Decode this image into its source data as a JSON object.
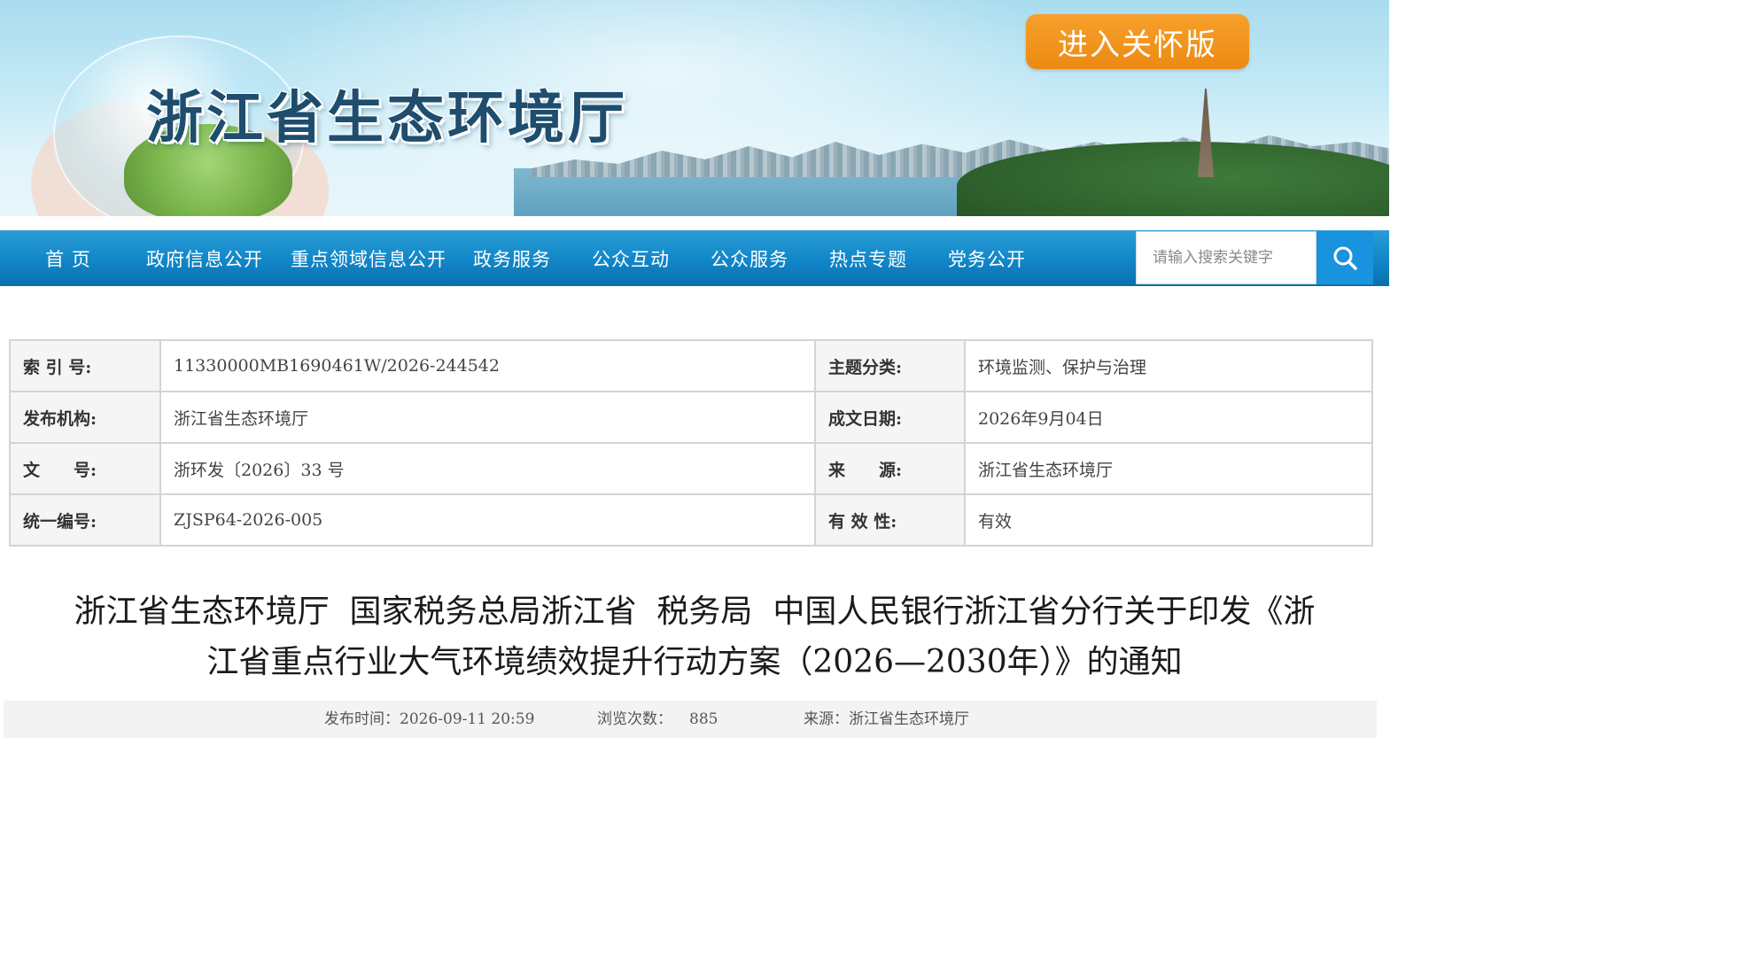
{
  "header": {
    "site_title": "浙江省生态环境厅",
    "care_button": "进入关怀版"
  },
  "nav": {
    "items": [
      "首 页",
      "政府信息公开",
      "重点领域信息公开",
      "政务服务",
      "公众互动",
      "公众服务",
      "热点专题",
      "党务公开"
    ],
    "search_placeholder": "请输入搜索关键字"
  },
  "meta": {
    "rows": [
      {
        "k1": "索 引 号:",
        "v1": "11330000MB1690461W/2026-244542",
        "k2": "主题分类:",
        "v2": "环境监测、保护与治理"
      },
      {
        "k1": "发布机构:",
        "v1": "浙江省生态环境厅",
        "k2": "成文日期:",
        "v2": "2026年9月04日"
      },
      {
        "k1": "文　　号:",
        "v1": "浙环发〔2026〕33 号",
        "k2": "来　　源:",
        "v2": "浙江省生态环境厅"
      },
      {
        "k1": "统一编号:",
        "v1": "ZJSP64-2026-005",
        "k2": "有 效 性:",
        "v2": "有效"
      }
    ]
  },
  "article": {
    "title_line1": "浙江省生态环境厅  国家税务总局浙江省  税务局  中国人民银行浙江省分行关于印发《浙",
    "title_line2": "江省重点行业大气环境绩效提升行动方案（2026—2030年）》的通知",
    "publish_time": "发布时间：2026-09-11 20:59",
    "views_label": "浏览次数：",
    "views_count": "885",
    "source": "来源：浙江省生态环境厅"
  },
  "colors": {
    "nav_blue": "#1186c8",
    "care_orange": "#ec8a12",
    "title_blue": "#1e4d6e"
  }
}
